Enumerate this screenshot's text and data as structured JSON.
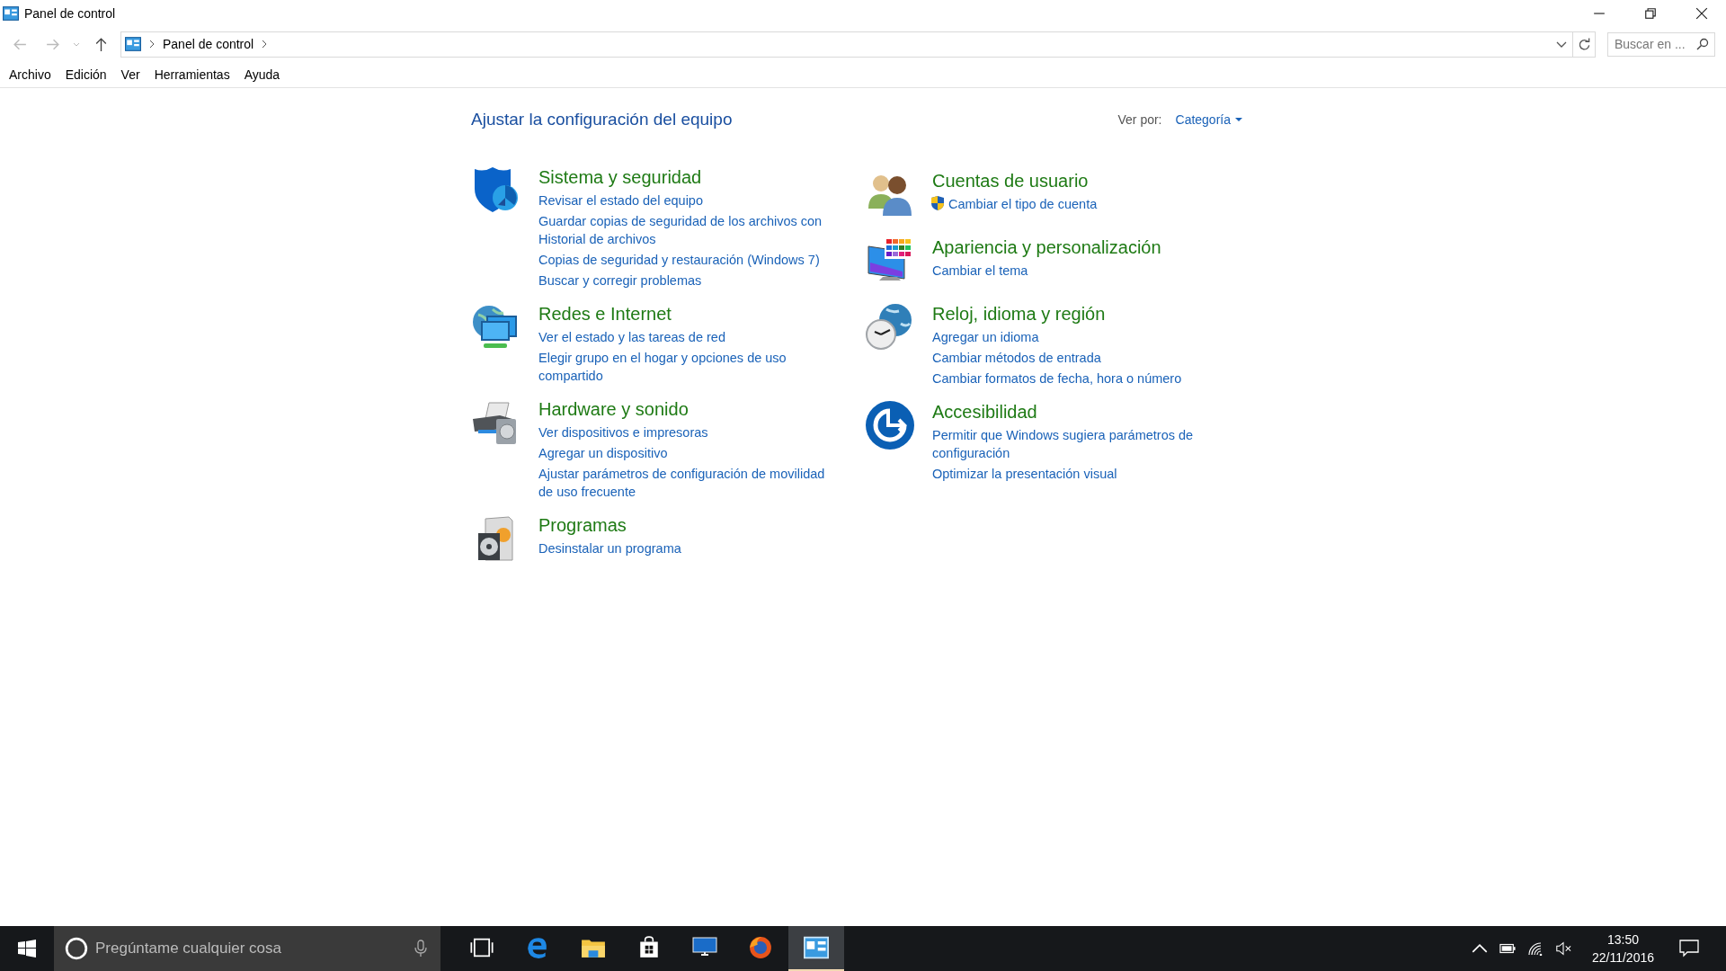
{
  "window": {
    "title": "Panel de control"
  },
  "address_bar": {
    "breadcrumb": "Panel de control",
    "search_placeholder": "Buscar en ..."
  },
  "menu": [
    "Archivo",
    "Edición",
    "Ver",
    "Herramientas",
    "Ayuda"
  ],
  "content": {
    "heading": "Ajustar la configuración del equipo",
    "view_by_label": "Ver por:",
    "view_by_value": "Categoría",
    "columns": [
      [
        {
          "title": "Sistema y seguridad",
          "links": [
            {
              "text": "Revisar el estado del equipo",
              "elevated": false
            },
            {
              "text": "Guardar copias de seguridad de los archivos con Historial de archivos",
              "elevated": false
            },
            {
              "text": "Copias de seguridad y restauración (Windows 7)",
              "elevated": false
            },
            {
              "text": "Buscar y corregir problemas",
              "elevated": false
            }
          ]
        },
        {
          "title": "Redes e Internet",
          "links": [
            {
              "text": "Ver el estado y las tareas de red",
              "elevated": false
            },
            {
              "text": "Elegir grupo en el hogar y opciones de uso compartido",
              "elevated": false
            }
          ]
        },
        {
          "title": "Hardware y sonido",
          "links": [
            {
              "text": "Ver dispositivos e impresoras",
              "elevated": false
            },
            {
              "text": "Agregar un dispositivo",
              "elevated": false
            },
            {
              "text": "Ajustar parámetros de configuración de movilidad de uso frecuente",
              "elevated": false
            }
          ]
        },
        {
          "title": "Programas",
          "links": [
            {
              "text": "Desinstalar un programa",
              "elevated": false
            }
          ]
        }
      ],
      [
        {
          "title": "Cuentas de usuario",
          "links": [
            {
              "text": "Cambiar el tipo de cuenta",
              "elevated": true
            }
          ]
        },
        {
          "title": "Apariencia y personalización",
          "links": [
            {
              "text": "Cambiar el tema",
              "elevated": false
            }
          ]
        },
        {
          "title": "Reloj, idioma y región",
          "links": [
            {
              "text": "Agregar un idioma",
              "elevated": false
            },
            {
              "text": "Cambiar métodos de entrada",
              "elevated": false
            },
            {
              "text": "Cambiar formatos de fecha, hora o número",
              "elevated": false
            }
          ]
        },
        {
          "title": "Accesibilidad",
          "links": [
            {
              "text": "Permitir que Windows sugiera parámetros de configuración",
              "elevated": false
            },
            {
              "text": "Optimizar la presentación visual",
              "elevated": false
            }
          ]
        }
      ]
    ]
  },
  "taskbar": {
    "search_placeholder": "Pregúntame cualquier cosa",
    "apps": [
      {
        "selected": false
      },
      {
        "selected": false
      },
      {
        "selected": false
      },
      {
        "selected": false
      },
      {
        "selected": false
      },
      {
        "selected": false
      },
      {
        "selected": true
      }
    ],
    "time": "13:50",
    "date": "22/11/2016"
  }
}
